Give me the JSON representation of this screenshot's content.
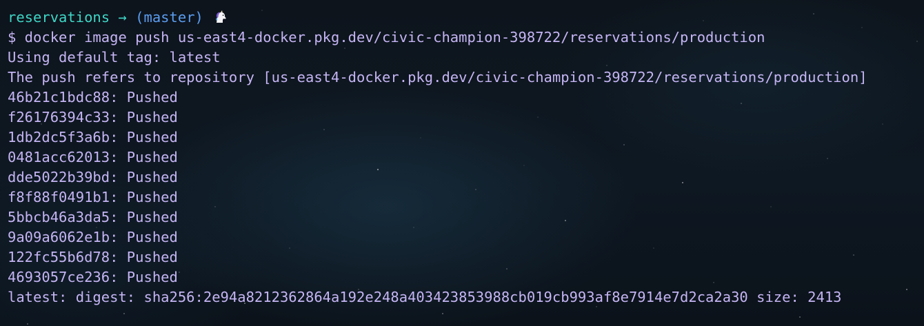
{
  "prompt": {
    "directory": "reservations",
    "arrow": "→",
    "branch": "(master)",
    "icon": "unicorn-icon"
  },
  "command_line": "$ docker image push us-east4-docker.pkg.dev/civic-champion-398722/reservations/production",
  "output": [
    "Using default tag: latest",
    "The push refers to repository [us-east4-docker.pkg.dev/civic-champion-398722/reservations/production]",
    "46b21c1bdc88: Pushed",
    "f26176394c33: Pushed",
    "1db2dc5f3a6b: Pushed",
    "0481acc62013: Pushed",
    "dde5022b39bd: Pushed",
    "f8f88f0491b1: Pushed",
    "5bbcb46a3da5: Pushed",
    "9a09a6062e1b: Pushed",
    "122fc55b6d78: Pushed",
    "4693057ce236: Pushed",
    "latest: digest: sha256:2e94a8212362864a192e248a403423853988cb019cb993af8e7914e7d2ca2a30 size: 2413"
  ],
  "colors": {
    "prompt_directory": "#3fd6c6",
    "prompt_branch": "#5b9df0",
    "output_text": "#c5b5f4",
    "background": "#0c131b"
  }
}
